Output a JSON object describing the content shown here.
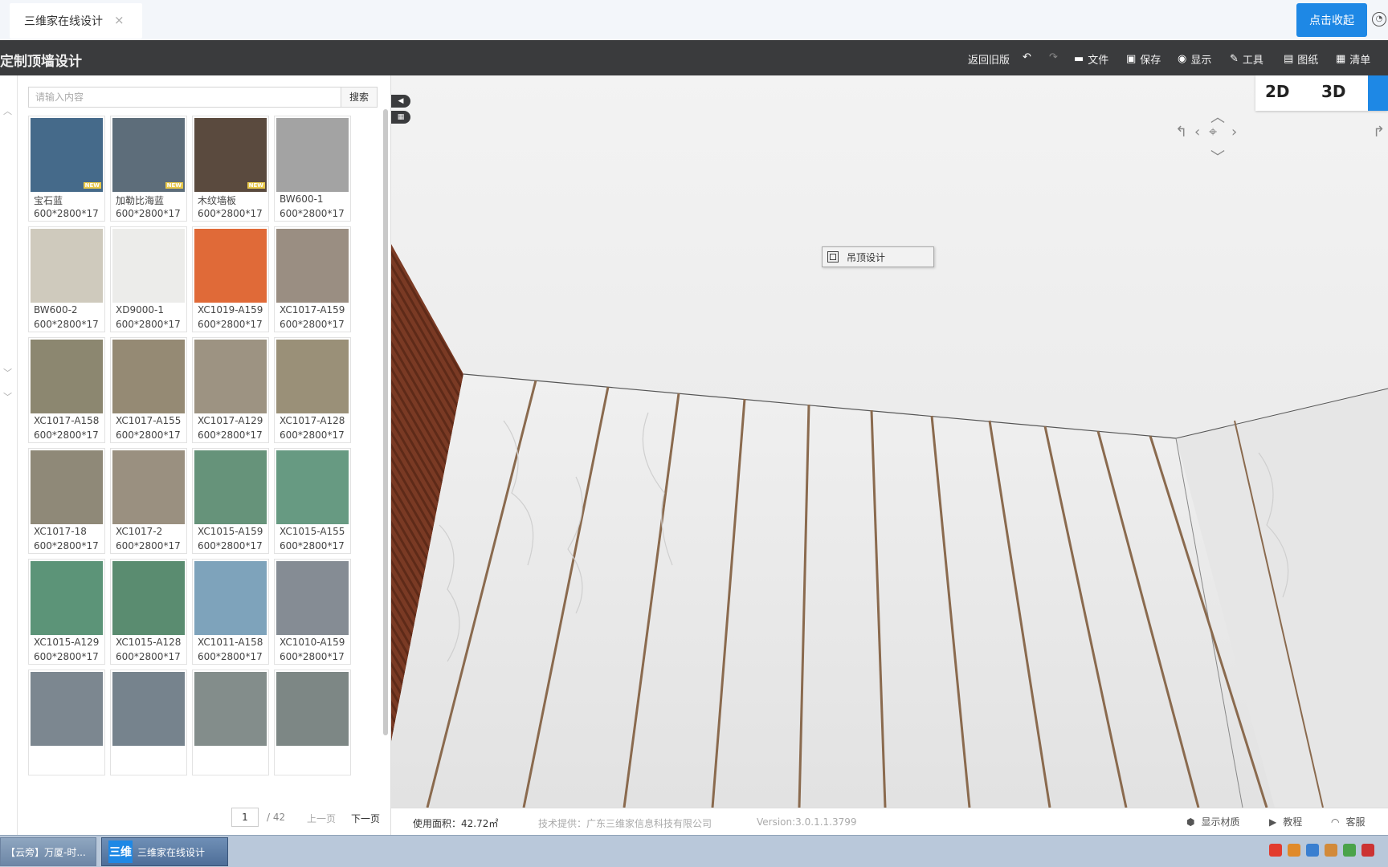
{
  "browser": {
    "tab_title": "三维家在线设计",
    "tab_close": "×",
    "collapse_label": "点击收起"
  },
  "toolbar": {
    "app_title": "定制顶墙设计",
    "items": [
      {
        "label": "返回旧版",
        "icon": ""
      },
      {
        "label": "",
        "icon": "undo-icon"
      },
      {
        "label": "",
        "icon": "redo-icon"
      },
      {
        "label": "文件",
        "icon": "folder-icon"
      },
      {
        "label": "保存",
        "icon": "save-icon"
      },
      {
        "label": "显示",
        "icon": "eye-icon"
      },
      {
        "label": "工具",
        "icon": "wrench-icon"
      },
      {
        "label": "图纸",
        "icon": "map-icon"
      },
      {
        "label": "清单",
        "icon": "list-icon"
      }
    ]
  },
  "search": {
    "placeholder": "请输入内容",
    "button_label": "搜索"
  },
  "materials": [
    {
      "name": "宝石蓝",
      "size": "600*2800*17",
      "color": "#456a8a",
      "new": true
    },
    {
      "name": "加勒比海蓝",
      "size": "600*2800*17",
      "color": "#5d6d7a",
      "new": true
    },
    {
      "name": "木纹墙板",
      "size": "600*2800*17",
      "color": "#5a4a3e",
      "new": true
    },
    {
      "name": "BW600-1",
      "size": "600*2800*17",
      "color": "#a3a3a3",
      "new": false
    },
    {
      "name": "BW600-2",
      "size": "600*2800*17",
      "color": "#cfcabd",
      "new": false
    },
    {
      "name": "XD9000-1",
      "size": "600*2800*17",
      "color": "#ececea",
      "new": false
    },
    {
      "name": "XC1019-A159",
      "size": "600*2800*17",
      "color": "#e06a38",
      "new": false
    },
    {
      "name": "XC1017-A159",
      "size": "600*2800*17",
      "color": "#9a8e82",
      "new": false
    },
    {
      "name": "XC1017-A158",
      "size": "600*2800*17",
      "color": "#8c8770",
      "new": false
    },
    {
      "name": "XC1017-A155",
      "size": "600*2800*17",
      "color": "#958a74",
      "new": false
    },
    {
      "name": "XC1017-A129",
      "size": "600*2800*17",
      "color": "#9d9382",
      "new": false
    },
    {
      "name": "XC1017-A128",
      "size": "600*2800*17",
      "color": "#9a9078",
      "new": false
    },
    {
      "name": "XC1017-18",
      "size": "600*2800*17",
      "color": "#8f8978",
      "new": false
    },
    {
      "name": "XC1017-2",
      "size": "600*2800*17",
      "color": "#9a9080",
      "new": false
    },
    {
      "name": "XC1015-A159",
      "size": "600*2800*17",
      "color": "#66937a",
      "new": false
    },
    {
      "name": "XC1015-A155",
      "size": "600*2800*17",
      "color": "#679a82",
      "new": false
    },
    {
      "name": "XC1015-A129",
      "size": "600*2800*17",
      "color": "#5c9478",
      "new": false
    },
    {
      "name": "XC1015-A128",
      "size": "600*2800*17",
      "color": "#5a8c70",
      "new": false
    },
    {
      "name": "XC1011-A158",
      "size": "600*2800*17",
      "color": "#7ea3bb",
      "new": false
    },
    {
      "name": "XC1010-A159",
      "size": "600*2800*17",
      "color": "#858c94",
      "new": false
    },
    {
      "name": "",
      "size": "",
      "color": "#7c8790",
      "new": false
    },
    {
      "name": "",
      "size": "",
      "color": "#76838d",
      "new": false
    },
    {
      "name": "",
      "size": "",
      "color": "#838d8b",
      "new": false
    },
    {
      "name": "",
      "size": "",
      "color": "#7d8785",
      "new": false
    }
  ],
  "pager": {
    "current": "1",
    "total": "/ 42",
    "prev": "上一页",
    "next": "下一页"
  },
  "viewport": {
    "mode_2d": "2D",
    "mode_3d": "3D",
    "context_menu_item": "吊顶设计"
  },
  "statusbar": {
    "area": "使用面积：42.72㎡",
    "tech": "技术提供：广东三维家信息科技有限公司",
    "version": "Version:3.0.1.1.3799",
    "show_material": "显示材质",
    "tutorial": "教程",
    "support": "客服"
  },
  "taskbar": {
    "task1": "【云旁】万厦-时...",
    "task2": "三维家在线设计",
    "task2_icon": "三维"
  },
  "colors": {
    "accent": "#1e88e5",
    "toolbar_bg": "#3a3b3d"
  }
}
